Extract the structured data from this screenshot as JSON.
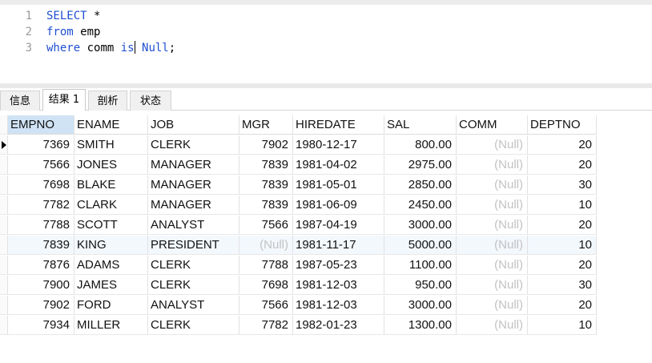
{
  "editor": {
    "lines": [
      {
        "num": "1",
        "parts": [
          {
            "t": "SELECT",
            "c": "kw"
          },
          {
            "t": " *",
            "c": "plain"
          }
        ]
      },
      {
        "num": "2",
        "parts": [
          {
            "t": "from",
            "c": "kw"
          },
          {
            "t": " emp",
            "c": "plain"
          }
        ]
      },
      {
        "num": "3",
        "parts": [
          {
            "t": "where",
            "c": "kw"
          },
          {
            "t": " comm ",
            "c": "plain"
          },
          {
            "t": "is",
            "c": "kw"
          },
          {
            "t": "|",
            "c": "caret"
          },
          {
            "t": " Null",
            "c": "kw"
          },
          {
            "t": ";",
            "c": "plain"
          }
        ]
      }
    ]
  },
  "tabs": [
    {
      "label": "信息",
      "active": false
    },
    {
      "label": "结果 1",
      "active": true
    },
    {
      "label": "剖析",
      "active": false
    },
    {
      "label": "状态",
      "active": false
    }
  ],
  "grid": {
    "columns": [
      "EMPNO",
      "ENAME",
      "JOB",
      "MGR",
      "HIREDATE",
      "SAL",
      "COMM",
      "DEPTNO"
    ],
    "null_text": "(Null)",
    "rows": [
      [
        "7369",
        "SMITH",
        "CLERK",
        "7902",
        "1980-12-17",
        "800.00",
        "(Null)",
        "20"
      ],
      [
        "7566",
        "JONES",
        "MANAGER",
        "7839",
        "1981-04-02",
        "2975.00",
        "(Null)",
        "20"
      ],
      [
        "7698",
        "BLAKE",
        "MANAGER",
        "7839",
        "1981-05-01",
        "2850.00",
        "(Null)",
        "30"
      ],
      [
        "7782",
        "CLARK",
        "MANAGER",
        "7839",
        "1981-06-09",
        "2450.00",
        "(Null)",
        "10"
      ],
      [
        "7788",
        "SCOTT",
        "ANALYST",
        "7566",
        "1987-04-19",
        "3000.00",
        "(Null)",
        "20"
      ],
      [
        "7839",
        "KING",
        "PRESIDENT",
        "(Null)",
        "1981-11-17",
        "5000.00",
        "(Null)",
        "10"
      ],
      [
        "7876",
        "ADAMS",
        "CLERK",
        "7788",
        "1987-05-23",
        "1100.00",
        "(Null)",
        "20"
      ],
      [
        "7900",
        "JAMES",
        "CLERK",
        "7698",
        "1981-12-03",
        "950.00",
        "(Null)",
        "30"
      ],
      [
        "7902",
        "FORD",
        "ANALYST",
        "7566",
        "1981-12-03",
        "3000.00",
        "(Null)",
        "20"
      ],
      [
        "7934",
        "MILLER",
        "CLERK",
        "7782",
        "1982-01-23",
        "1300.00",
        "(Null)",
        "10"
      ]
    ],
    "current_row": 0,
    "highlight_row": 5,
    "selected_column": 0
  }
}
